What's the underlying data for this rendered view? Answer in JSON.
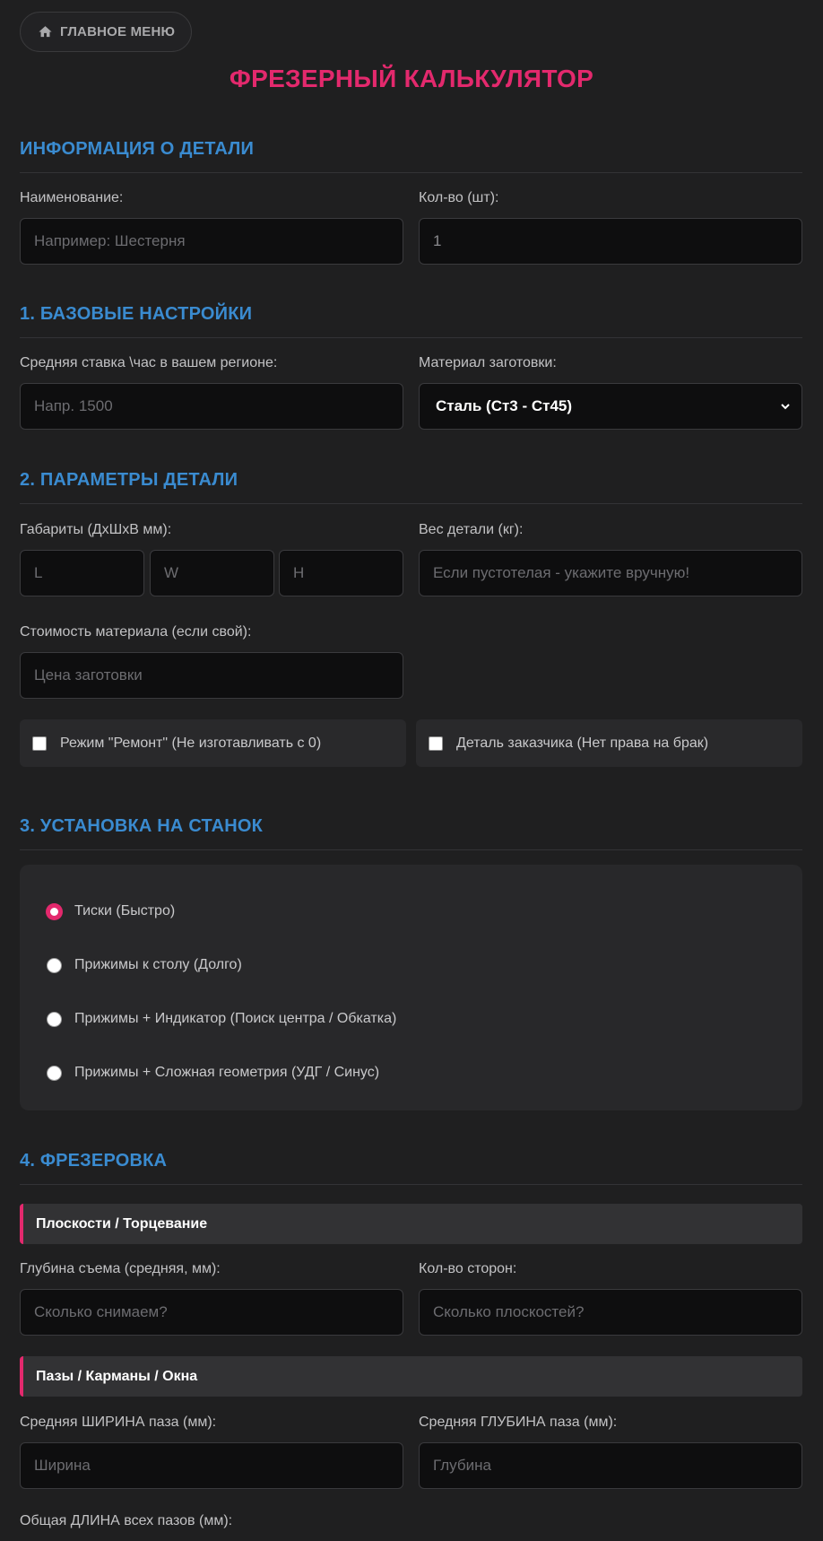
{
  "nav": {
    "home_label": "ГЛАВНОЕ МЕНЮ"
  },
  "page_title": "ФРЕЗЕРНЫЙ КАЛЬКУЛЯТОР",
  "sections": {
    "part_info": "ИНФОРМАЦИЯ О ДЕТАЛИ",
    "base": "1. БАЗОВЫЕ НАСТРОЙКИ",
    "params": "2. ПАРАМЕТРЫ ДЕТАЛИ",
    "setup": "3. УСТАНОВКА НА СТАНОК",
    "milling": "4. ФРЕЗЕРОВКА"
  },
  "part_info": {
    "name_label": "Наименование:",
    "name_placeholder": "Например: Шестерня",
    "qty_label": "Кол-во (шт):",
    "qty_value": "1"
  },
  "base": {
    "rate_label": "Средняя ставка \\час в вашем регионе:",
    "rate_placeholder": "Напр. 1500",
    "material_label": "Материал заготовки:",
    "material_selected": "Сталь (Ст3 - Ст45)"
  },
  "params": {
    "dims_label": "Габариты (ДхШхВ мм):",
    "dim_l": "L",
    "dim_w": "W",
    "dim_h": "H",
    "weight_label": "Вес детали (кг):",
    "weight_placeholder": "Если пустотелая - укажите вручную!",
    "material_cost_label": "Стоимость материала (если свой):",
    "material_cost_placeholder": "Цена заготовки",
    "repair_mode": "Режим \"Ремонт\" (Не изготавливать с 0)",
    "customer_part": "Деталь заказчика (Нет права на брак)"
  },
  "setup": {
    "options": [
      {
        "label": "Тиски (Быстро)",
        "selected": true
      },
      {
        "label": "Прижимы к столу (Долго)",
        "selected": false
      },
      {
        "label": "Прижимы + Индикатор (Поиск центра / Обкатка)",
        "selected": false
      },
      {
        "label": "Прижимы + Сложная геометрия (УДГ / Синус)",
        "selected": false
      }
    ]
  },
  "milling": {
    "planes_header": "Плоскости / Торцевание",
    "depth_label": "Глубина съема (средняя, мм):",
    "depth_placeholder": "Сколько снимаем?",
    "sides_label": "Кол-во сторон:",
    "sides_placeholder": "Сколько плоскостей?",
    "slots_header": "Пазы / Карманы / Окна",
    "slot_width_label": "Средняя ШИРИНА паза (мм):",
    "slot_width_placeholder": "Ширина",
    "slot_depth_label": "Средняя ГЛУБИНА паза (мм):",
    "slot_depth_placeholder": "Глубина",
    "slot_length_label": "Общая ДЛИНА всех пазов (мм):"
  },
  "colors": {
    "accent": "#e3296d",
    "section": "#3a8bd0",
    "background": "#1f1f20"
  }
}
